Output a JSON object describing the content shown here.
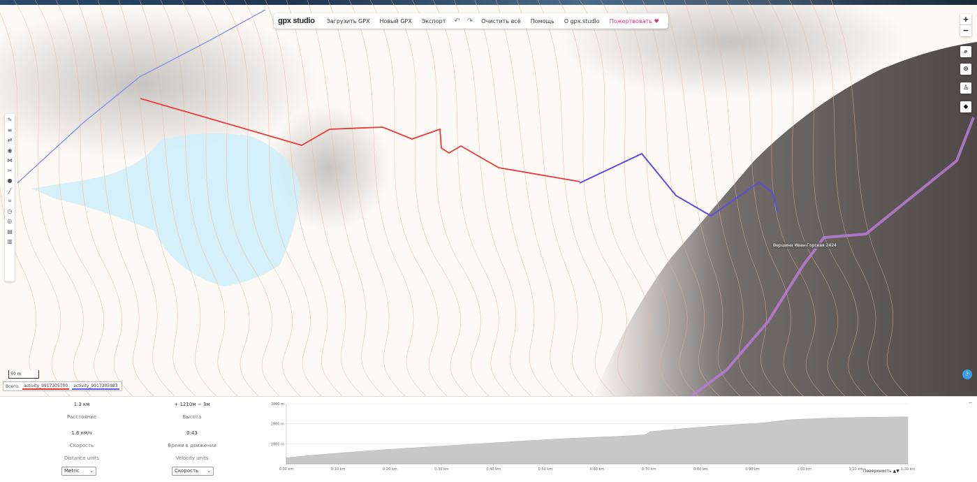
{
  "app": {
    "logo": "gpx studio",
    "menu": [
      "Загрузить GPX",
      "Новый GPX",
      "Экспорт",
      "Очистить всё",
      "Помощь",
      "О gpx.studio"
    ],
    "donate": "Пожертвовать",
    "undo_icon": "↶",
    "redo_icon": "↷"
  },
  "map": {
    "zoom_in": "+",
    "zoom_out": "−",
    "scale_label": "50 m",
    "poi_label": "Вершина Иван-Горская 2424",
    "tracks_prefix": "Всего:",
    "tracks": [
      "activity_9917305700",
      "activity_9917305983"
    ],
    "help": "?"
  },
  "stats": {
    "distance_value": "1.3 км",
    "distance_label": "Расстояние",
    "elevation_value": "+ 1210м − 3м",
    "elevation_label": "Высота",
    "speed_value": "1.6 км/ч",
    "speed_label": "Скорость",
    "time_value": "0:43",
    "time_label": "Время в движении",
    "distance_units_label": "Distance units",
    "velocity_units_label": "Velocity units",
    "distance_units_value": "Metric",
    "velocity_units_value": "Скорость"
  },
  "chart_data": {
    "type": "area",
    "x": [
      "0:00 km",
      "0:10 km",
      "0:20 km",
      "0:30 km",
      "0:40 km",
      "0:50 km",
      "0:60 km",
      "0:70 km",
      "0:80 km",
      "0:90 km",
      "1:00 km",
      "1:10 km",
      "1:20 km"
    ],
    "y_ticks": [
      "3000 m",
      "2000 m",
      "1000 m"
    ],
    "ylim": [
      0,
      3000
    ],
    "profile": [
      [
        0,
        300
      ],
      [
        0.05,
        420
      ],
      [
        0.1,
        520
      ],
      [
        0.2,
        700
      ],
      [
        0.3,
        850
      ],
      [
        0.4,
        1000
      ],
      [
        0.5,
        1150
      ],
      [
        0.6,
        1280
      ],
      [
        0.7,
        1380
      ],
      [
        0.75,
        1450
      ],
      [
        0.76,
        1600
      ],
      [
        0.8,
        1700
      ],
      [
        0.9,
        1900
      ],
      [
        1.0,
        2050
      ],
      [
        1.05,
        2200
      ],
      [
        1.15,
        2300
      ],
      [
        1.3,
        2350
      ]
    ],
    "xlim": [
      0,
      1.3
    ],
    "control_label": "Поверхность"
  }
}
